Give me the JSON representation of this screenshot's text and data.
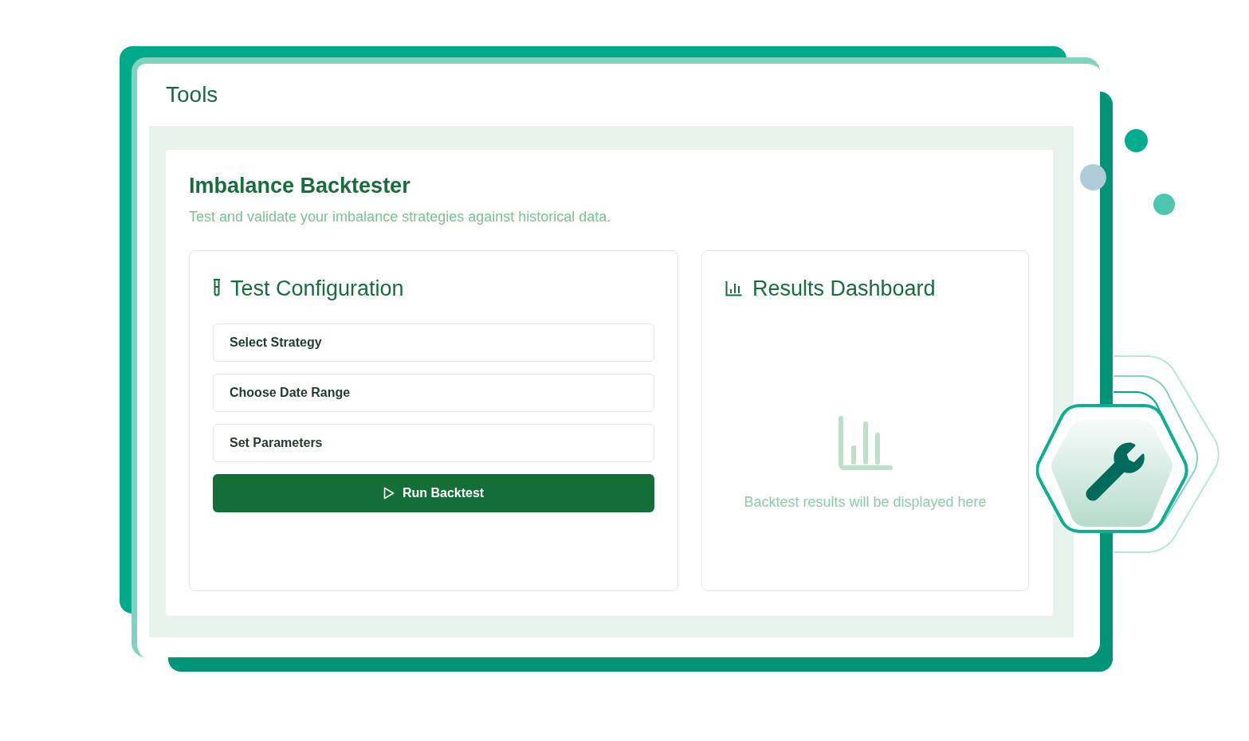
{
  "window": {
    "title": "Tools"
  },
  "tool": {
    "title": "Imbalance Backtester",
    "subtitle": "Test and validate your imbalance strategies against historical data."
  },
  "configuration": {
    "title": "Test Configuration",
    "steps": [
      {
        "label": "Select Strategy"
      },
      {
        "label": "Choose Date Range"
      },
      {
        "label": "Set Parameters"
      }
    ],
    "run_button": "Run Backtest"
  },
  "results": {
    "title": "Results Dashboard",
    "empty_message": "Backtest results will be displayed here"
  }
}
